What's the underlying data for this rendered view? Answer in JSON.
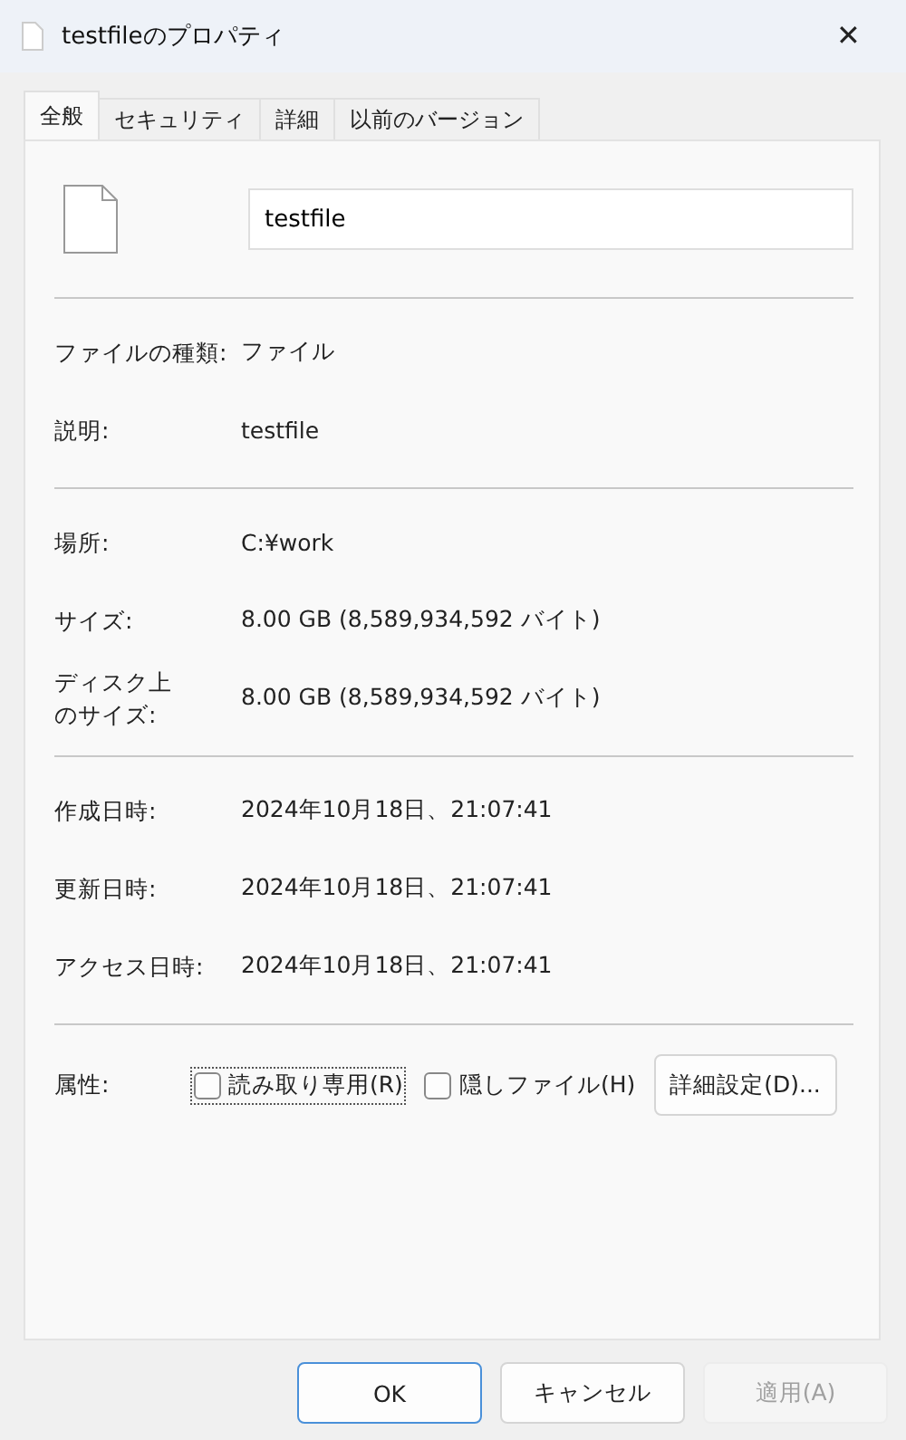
{
  "window": {
    "title": "testfileのプロパティ",
    "close": "✕"
  },
  "tabs": [
    {
      "label": "全般",
      "selected": true
    },
    {
      "label": "セキュリティ",
      "selected": false
    },
    {
      "label": "詳細",
      "selected": false
    },
    {
      "label": "以前のバージョン",
      "selected": false
    }
  ],
  "file_name": {
    "value": "testfile"
  },
  "sections": [
    [
      {
        "label": "ファイルの種類:",
        "value": "ファイル"
      },
      {
        "label": "説明:",
        "value": "testfile"
      }
    ],
    [
      {
        "label": "場所:",
        "value": "C:¥work"
      },
      {
        "label": "サイズ:",
        "value": "8.00 GB (8,589,934,592 バイト)"
      },
      {
        "label": "ディスク上のサイズ:",
        "kind": "wrapped",
        "value": "8.00 GB (8,589,934,592 バイト)"
      }
    ],
    [
      {
        "label": "作成日時:",
        "value": "2024年10月18日、21:07:41"
      },
      {
        "label": "更新日時:",
        "value": "2024年10月18日、21:07:41"
      },
      {
        "label": "アクセス日時:",
        "value": "2024年10月18日、21:07:41"
      }
    ]
  ],
  "attributes": {
    "label": "属性:",
    "options": [
      {
        "label": "読み取り専用(R)",
        "checked": false,
        "focused": true
      },
      {
        "label": "隠しファイル(H)",
        "checked": false,
        "focused": false
      }
    ],
    "advanced": "詳細設定(D)..."
  },
  "buttons": [
    {
      "label": "OK",
      "default": true,
      "disabled": false
    },
    {
      "label": "キャンセル",
      "default": false,
      "disabled": false
    },
    {
      "label": "適用(A)",
      "default": false,
      "disabled": true
    }
  ]
}
